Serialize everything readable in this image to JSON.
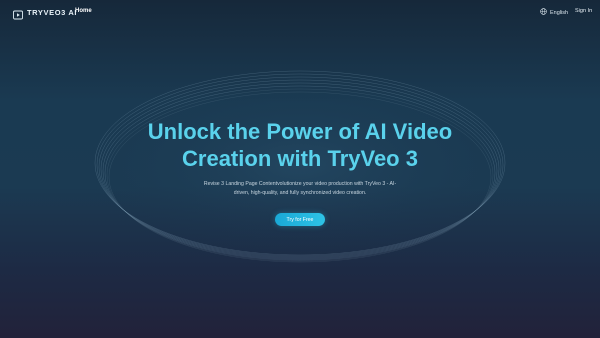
{
  "nav": {
    "brand": "TRYVEO3 AI",
    "home": "Home",
    "language": "English",
    "sign_in": "Sign In"
  },
  "hero": {
    "title_line1": "Unlock the Power of AI Video",
    "title_line2": "Creation with TryVeo 3",
    "subtitle_line1": "Revise 3 Landing Page Contentvolutionize your video production with TryVeo 3 - AI-",
    "subtitle_line2": "driven, high-quality, and fully synchronized video creation.",
    "cta": "Try for Free"
  },
  "colors": {
    "accent": "#5ad2ec",
    "button": "#1fb2dc",
    "background_top": "#16283a",
    "background_bottom": "#22223a"
  },
  "icons": {
    "logo": "play-square-icon",
    "language": "globe-icon"
  }
}
